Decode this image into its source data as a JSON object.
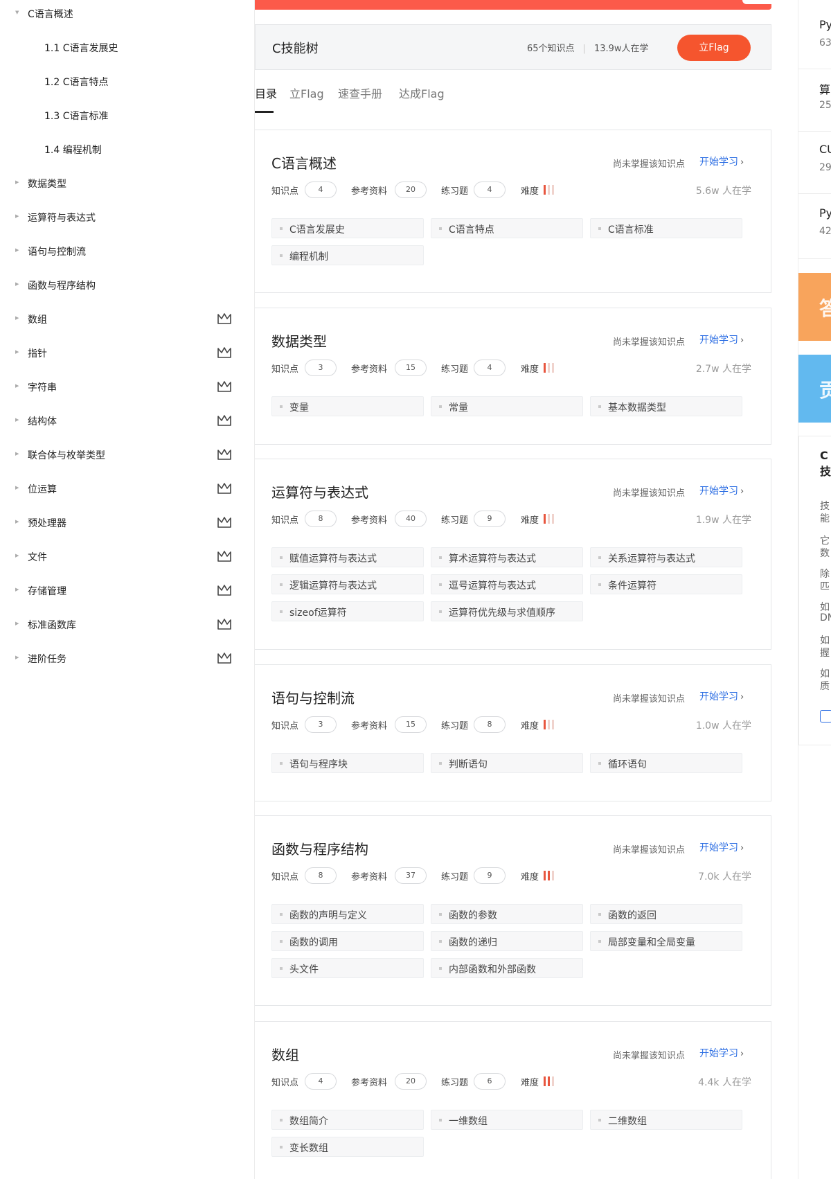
{
  "sidebar": {
    "items": [
      {
        "label": "C语言概述",
        "level": "top",
        "expanded": true,
        "vip": false
      },
      {
        "label": "1.1 C语言发展史",
        "level": "sub",
        "vip": false
      },
      {
        "label": "1.2 C语言特点",
        "level": "sub",
        "vip": false
      },
      {
        "label": "1.3 C语言标准",
        "level": "sub",
        "vip": false
      },
      {
        "label": "1.4 编程机制",
        "level": "sub",
        "vip": false
      },
      {
        "label": "数据类型",
        "level": "top",
        "vip": false
      },
      {
        "label": "运算符与表达式",
        "level": "top",
        "vip": false
      },
      {
        "label": "语句与控制流",
        "level": "top",
        "vip": false
      },
      {
        "label": "函数与程序结构",
        "level": "top",
        "vip": false
      },
      {
        "label": "数组",
        "level": "top",
        "vip": true
      },
      {
        "label": "指针",
        "level": "top",
        "vip": true
      },
      {
        "label": "字符串",
        "level": "top",
        "vip": true
      },
      {
        "label": "结构体",
        "level": "top",
        "vip": true
      },
      {
        "label": "联合体与枚举类型",
        "level": "top",
        "vip": true
      },
      {
        "label": "位运算",
        "level": "top",
        "vip": true
      },
      {
        "label": "预处理器",
        "level": "top",
        "vip": true
      },
      {
        "label": "文件",
        "level": "top",
        "vip": true
      },
      {
        "label": "存储管理",
        "level": "top",
        "vip": true
      },
      {
        "label": "标准函数库",
        "level": "top",
        "vip": true
      },
      {
        "label": "进阶任务",
        "level": "top",
        "vip": true
      }
    ]
  },
  "header": {
    "title": "C技能树",
    "knowledge_count": "65个知识点",
    "learners": "13.9w人在学",
    "flag_button": "立Flag"
  },
  "tabs": [
    {
      "label": "目录",
      "active": true
    },
    {
      "label": "立Flag",
      "active": false
    },
    {
      "label": "速查手册",
      "active": false
    },
    {
      "label": "达成Flag",
      "active": false
    }
  ],
  "labels": {
    "knowledge": "知识点",
    "reference": "参考资料",
    "exercise": "练习题",
    "difficulty": "难度",
    "hint": "尚未掌握该知识点",
    "start": "开始学习"
  },
  "colors": {
    "accent_blue": "#2b6de3",
    "flag_orange": "#f5552e",
    "difficulty_red": "#e8563f",
    "difficulty_empty": "#f0d3cd",
    "top_banner": "#fc5a4a"
  },
  "sections": [
    {
      "title": "C语言概述",
      "knowledge": "4",
      "reference": "20",
      "exercise": "4",
      "difficulty": 1,
      "learners": "5.6w 人在学",
      "topics": [
        "C语言发展史",
        "C语言特点",
        "C语言标准",
        "编程机制"
      ]
    },
    {
      "title": "数据类型",
      "knowledge": "3",
      "reference": "15",
      "exercise": "4",
      "difficulty": 1,
      "learners": "2.7w 人在学",
      "topics": [
        "变量",
        "常量",
        "基本数据类型"
      ]
    },
    {
      "title": "运算符与表达式",
      "knowledge": "8",
      "reference": "40",
      "exercise": "9",
      "difficulty": 1,
      "learners": "1.9w 人在学",
      "topics": [
        "赋值运算符与表达式",
        "算术运算符与表达式",
        "关系运算符与表达式",
        "逻辑运算符与表达式",
        "逗号运算符与表达式",
        "条件运算符",
        "sizeof运算符",
        "运算符优先级与求值顺序"
      ]
    },
    {
      "title": "语句与控制流",
      "knowledge": "3",
      "reference": "15",
      "exercise": "8",
      "difficulty": 1,
      "learners": "1.0w 人在学",
      "topics": [
        "语句与程序块",
        "判断语句",
        "循环语句"
      ]
    },
    {
      "title": "函数与程序结构",
      "knowledge": "8",
      "reference": "37",
      "exercise": "9",
      "difficulty": 2,
      "learners": "7.0k 人在学",
      "topics": [
        "函数的声明与定义",
        "函数的参数",
        "函数的返回",
        "函数的调用",
        "函数的递归",
        "局部变量和全局变量",
        "头文件",
        "内部函数和外部函数"
      ]
    },
    {
      "title": "数组",
      "knowledge": "4",
      "reference": "20",
      "exercise": "6",
      "difficulty": 2,
      "learners": "4.4k 人在学",
      "topics": [
        "数组简介",
        "一维数组",
        "二维数组",
        "变长数组"
      ]
    }
  ],
  "right": {
    "items": [
      {
        "line1": "Py",
        "line2": "63"
      },
      {
        "line1": "算",
        "line2": "25"
      },
      {
        "line1": "CU",
        "line2": "29"
      },
      {
        "line1": "Py",
        "line2": "42"
      }
    ],
    "banners": [
      {
        "text": "答",
        "color": "#f8a45c"
      },
      {
        "text": "贡",
        "color": "#62b9ef"
      }
    ],
    "card_title": "C技",
    "card_lines": [
      "技",
      "能",
      "它",
      "数",
      "除",
      "匹",
      "如",
      "DN",
      "如",
      "握",
      "如",
      "质"
    ]
  }
}
